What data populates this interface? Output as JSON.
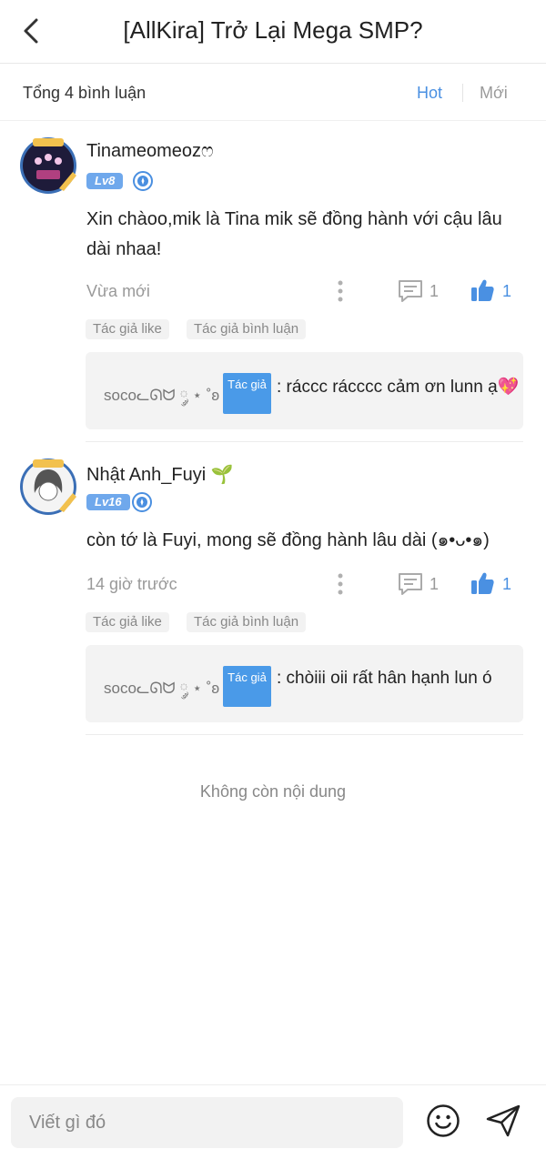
{
  "header": {
    "title": "[AllKira] Trở Lại Mega SMP?",
    "back_icon": "chevron-left-icon"
  },
  "subbar": {
    "total": "Tổng 4 bình luận",
    "tabs": [
      "Hot",
      "Mới"
    ],
    "active_tab": "Hot"
  },
  "comments": [
    {
      "username": "Tinameomeozෆ",
      "level": "Lv8",
      "text": "Xin chàoo,mik là Tina mik sẽ đồng hành với cậu lâu dài nhaa!",
      "time": "Vừa mới",
      "reply_count": "1",
      "like_count": "1",
      "tags": [
        "Tác giả like",
        "Tác giả bình luận"
      ],
      "reply": {
        "name": "socoᓚᘏᗢ ༘ ⋆ ˚ʚ",
        "label": "Tác giả",
        "text": ": ráccc rácccc cảm ơn lunn ạ💖"
      }
    },
    {
      "username": "Nhật Anh_Fuyi 🌱",
      "level": "Lv16",
      "text": "còn tớ là Fuyi, mong sẽ đồng hành lâu dài (๑•ᴗ•๑)",
      "time": "14 giờ trước",
      "reply_count": "1",
      "like_count": "1",
      "tags": [
        "Tác giả like",
        "Tác giả bình luận"
      ],
      "reply": {
        "name": "socoᓚᘏᗢ ༘ ⋆ ˚ʚ",
        "label": "Tác giả",
        "text": ": chòiii oii rất hân hạnh lun ó"
      }
    }
  ],
  "footer": {
    "no_more": "Không còn nội dung"
  },
  "composer": {
    "placeholder": "Viết gì đó",
    "emoji_icon": "smile-icon",
    "send_icon": "send-icon"
  },
  "colors": {
    "accent": "#4a90e2",
    "level_badge": "#6fa8ec",
    "author_label": "#4a9ae8",
    "reply_bg": "#f3f3f3"
  }
}
